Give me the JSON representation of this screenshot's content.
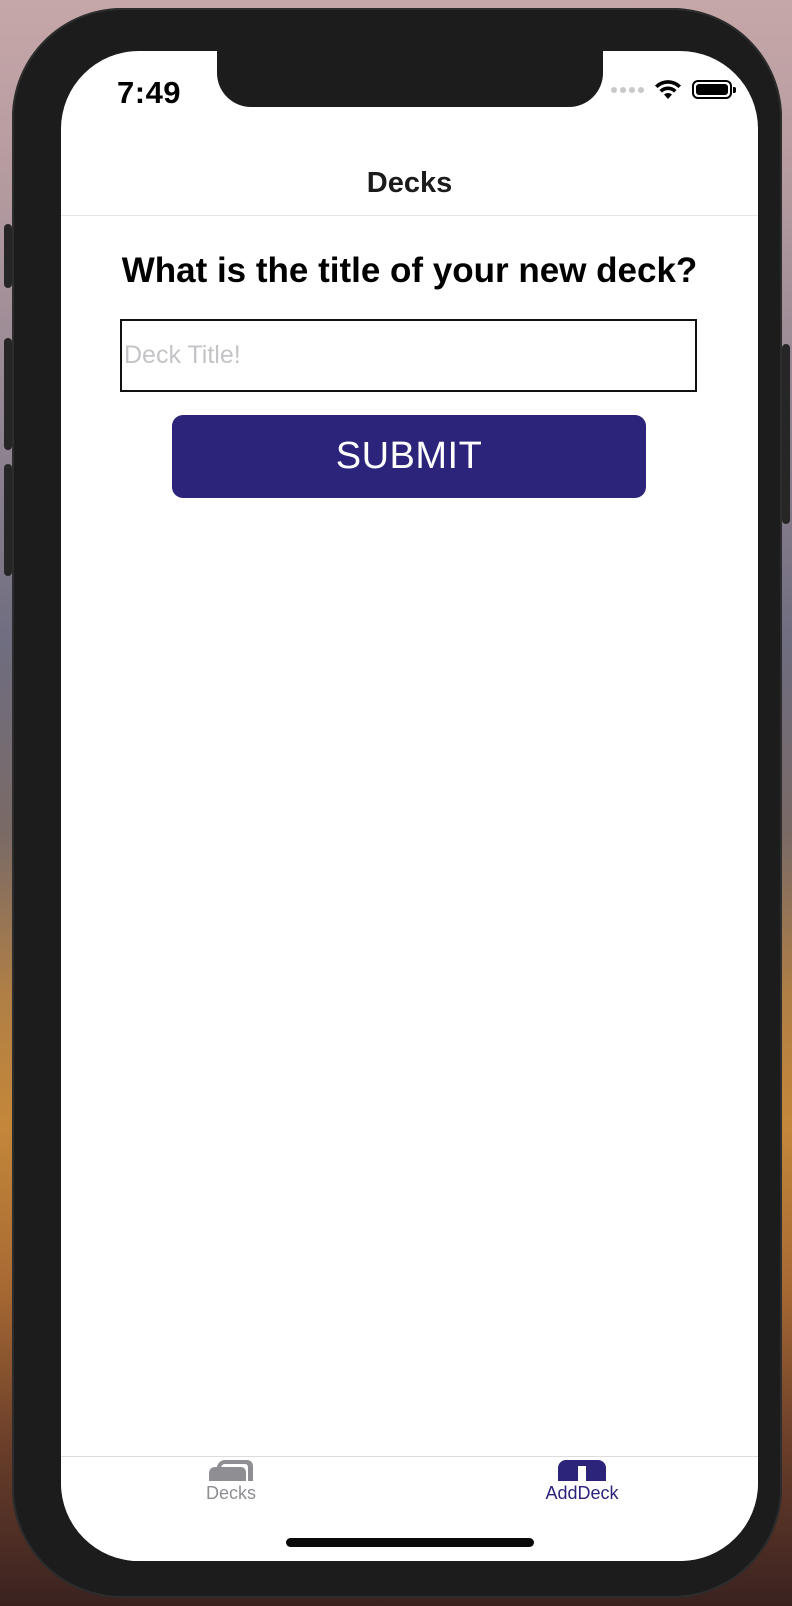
{
  "status_bar": {
    "time": "7:49"
  },
  "header": {
    "title": "Decks"
  },
  "form": {
    "question": "What is the title of your new deck?",
    "title_placeholder": "Deck Title!",
    "title_value": "",
    "submit_label": "SUBMIT"
  },
  "tab_bar": {
    "tabs": [
      {
        "label": "Decks",
        "icon": "cards-stack-icon",
        "active": false
      },
      {
        "label": "AddDeck",
        "icon": "add-deck-icon",
        "active": true
      }
    ]
  },
  "colors": {
    "accent": "#2c237a",
    "inactive_tab": "#8e8e93",
    "placeholder": "#c4c4c8"
  }
}
